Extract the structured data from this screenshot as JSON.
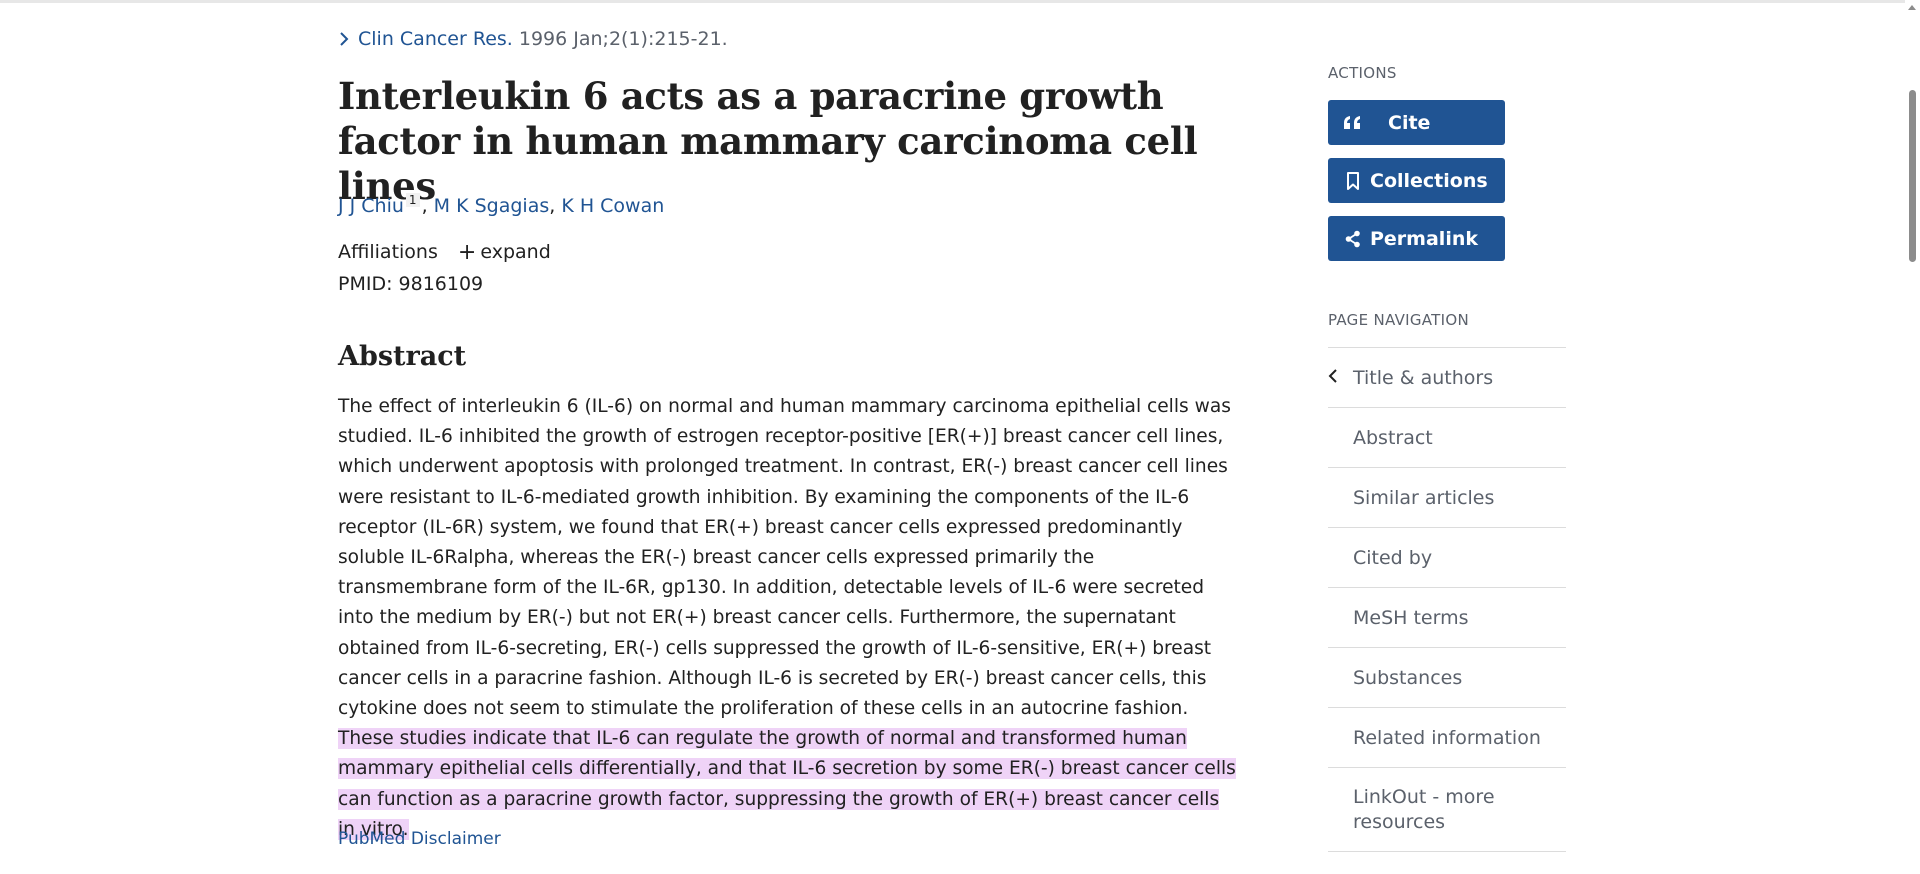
{
  "citation": {
    "journal": "Clin Cancer Res.",
    "details": "1996 Jan;2(1):215-21."
  },
  "article": {
    "title": "Interleukin 6 acts as a paracrine growth factor in human mammary carcinoma cell lines",
    "authors": [
      {
        "name": "J J Chiu",
        "affiliation_ref": "1"
      },
      {
        "name": "M K Sgagias"
      },
      {
        "name": "K H Cowan"
      }
    ],
    "affiliations_label": "Affiliations",
    "expand_label": "expand",
    "pmid": "PMID: 9816109"
  },
  "abstract": {
    "heading": "Abstract",
    "text": "The effect of interleukin 6 (IL-6) on normal and human mammary carcinoma epithelial cells was studied. IL-6 inhibited the growth of estrogen receptor-positive [ER(+)] breast cancer cell lines, which underwent apoptosis with prolonged treatment. In contrast, ER(-) breast cancer cell lines were resistant to IL-6-mediated growth inhibition. By examining the components of the IL-6 receptor (IL-6R) system, we found that ER(+) breast cancer cells expressed predominantly soluble IL-6Ralpha, whereas the ER(-) breast cancer cells expressed primarily the transmembrane form of the IL-6R, gp130. In addition, detectable levels of IL-6 were secreted into the medium by ER(-) but not ER(+) breast cancer cells. Furthermore, the supernatant obtained from IL-6-secreting, ER(-) cells suppressed the growth of IL-6-sensitive, ER(+) breast cancer cells in a paracrine fashion. Although IL-6 is secreted by ER(-) breast cancer cells, this cytokine does not seem to stimulate the proliferation of these cells in an autocrine fashion. ",
    "highlighted_text": "These studies indicate that IL-6 can regulate the growth of normal and transformed human mammary epithelial cells differentially, and that IL-6 secretion by some ER(-) breast cancer cells can function as a paracrine growth factor, suppressing the growth of ER(+) breast cancer cells in vitro.",
    "highlight_color": "#efd3f7",
    "disclaimer": "PubMed Disclaimer"
  },
  "sidebar": {
    "actions_heading": "ACTIONS",
    "actions": [
      {
        "label": "Cite",
        "icon": "quote-icon"
      },
      {
        "label": "Collections",
        "icon": "bookmark-icon"
      },
      {
        "label": "Permalink",
        "icon": "share-icon"
      }
    ],
    "nav_heading": "PAGE NAVIGATION",
    "nav_items": [
      {
        "label": "Title & authors"
      },
      {
        "label": "Abstract"
      },
      {
        "label": "Similar articles"
      },
      {
        "label": "Cited by"
      },
      {
        "label": "MeSH terms"
      },
      {
        "label": "Substances"
      },
      {
        "label": "Related information"
      },
      {
        "label": "LinkOut - more resources"
      }
    ]
  },
  "colors": {
    "link": "#205493",
    "button_bg": "#205493",
    "muted_text": "#5b616b"
  }
}
